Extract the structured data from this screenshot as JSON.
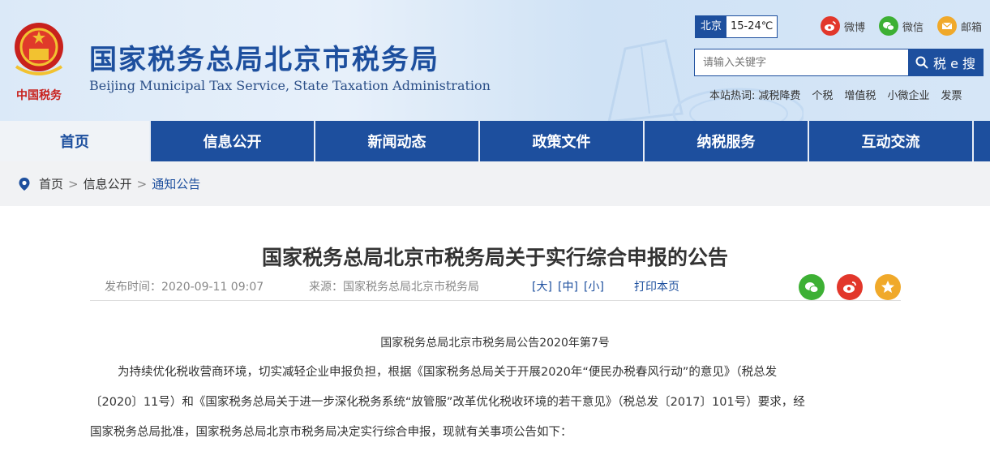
{
  "header": {
    "site_title": "国家税务总局北京市税务局",
    "site_subtitle": "Beijing Municipal Tax Service, State Taxation Administration",
    "logo_text": "中国税务",
    "weather": {
      "city": "北京",
      "temp": "15-24℃"
    },
    "social": {
      "weibo": "微博",
      "wechat": "微信",
      "email": "邮箱"
    },
    "search": {
      "placeholder": "请输入关键字",
      "button": "税 e 搜"
    },
    "hot": {
      "label": "本站热词:",
      "words": [
        "减税降费",
        "个税",
        "增值税",
        "小微企业",
        "发票"
      ]
    }
  },
  "nav": [
    "首页",
    "信息公开",
    "新闻动态",
    "政策文件",
    "纳税服务",
    "互动交流"
  ],
  "breadcrumb": {
    "home": "首页",
    "level1": "信息公开",
    "current": "通知公告",
    "sep": ">"
  },
  "article": {
    "title": "国家税务总局北京市税务局关于实行综合申报的公告",
    "publish": "发布时间：2020-09-11 09:07",
    "source": "来源：国家税务总局北京市税务局",
    "font_large": "[大]",
    "font_mid": "[中]",
    "font_small": "[小]",
    "print": "打印本页",
    "doc_no": "国家税务总局北京市税务局公告2020年第7号",
    "para1_line1": "为持续优化税收营商环境，切实减轻企业申报负担，根据《国家税务总局关于开展2020年“便民办税春风行动”的意见》（税总发",
    "para1_line2": "〔2020〕11号）和《国家税务总局关于进一步深化税务系统“放管服”改革优化税收环境的若干意见》（税总发〔2017〕101号）要求，经",
    "para1_line3": "国家税务总局批准，国家税务总局北京市税务局决定实行综合申报，现就有关事项公告如下："
  },
  "colors": {
    "brand": "#1d4f9e",
    "wechat": "#3db034",
    "weibo": "#e2372b",
    "star": "#f0a92a"
  }
}
